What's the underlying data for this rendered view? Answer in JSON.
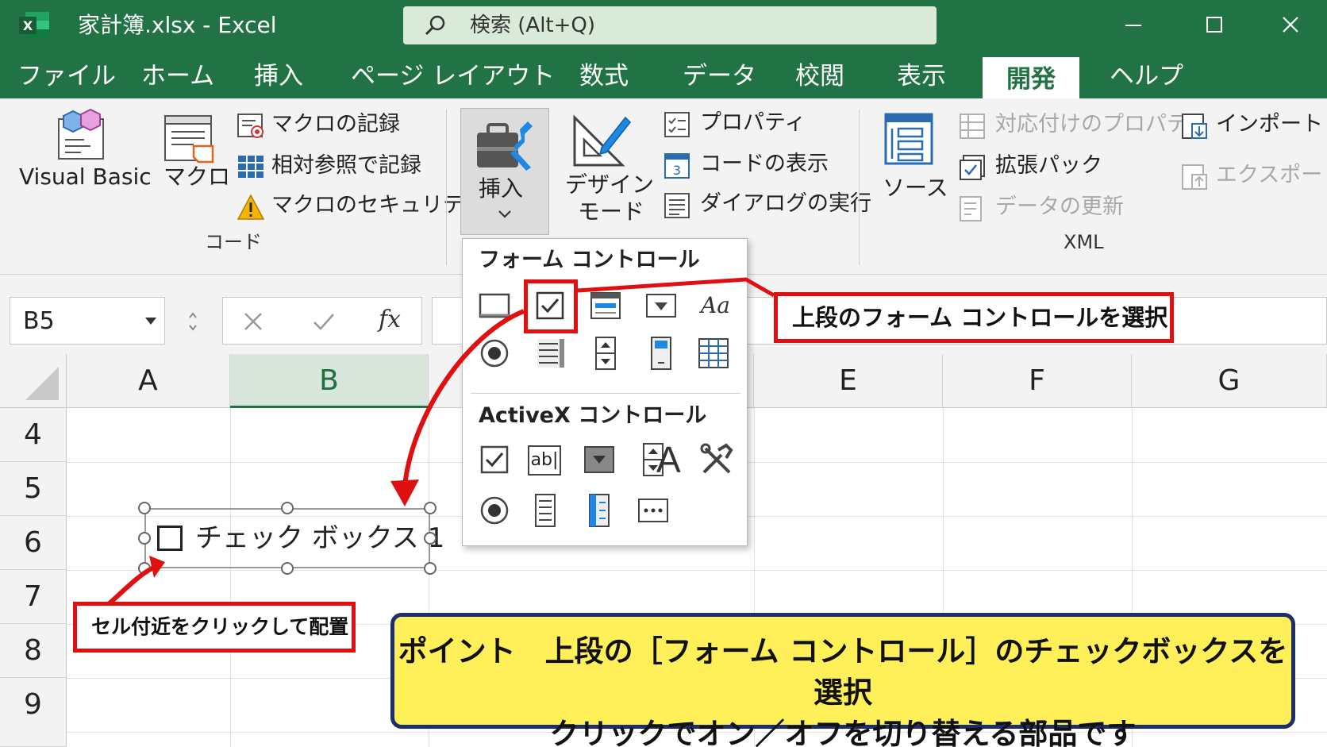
{
  "window": {
    "title": "家計簿.xlsx  -  Excel",
    "app_badge": "X",
    "search_text": "検索 (Alt+Q)"
  },
  "tabs": [
    "ファイル",
    "ホーム",
    "挿入",
    "ページ レイアウト",
    "数式",
    "データ",
    "校閲",
    "表示",
    "開発",
    "ヘルプ"
  ],
  "active_tab": "開発",
  "ribbon": {
    "code_group": {
      "visual_basic": "Visual Basic",
      "macro": "マクロ",
      "record_macro": "マクロの記録",
      "relative_ref": "相対参照で記録",
      "macro_security": "マクロのセキュリティ",
      "label": "コード"
    },
    "controls_group": {
      "insert": "挿入",
      "design_mode_1": "デザイン",
      "design_mode_2": "モード",
      "properties": "プロパティ",
      "view_code": "コードの表示",
      "run_dialog": "ダイアログの実行"
    },
    "xml_group": {
      "source": "ソース",
      "map_properties": "対応付けのプロパティ",
      "expansion_packs": "拡張パック",
      "refresh_data": "データの更新",
      "import": "インポート",
      "export": "エクスポート",
      "label": "XML"
    }
  },
  "formula_bar": {
    "name_box": "B5",
    "fx": "fx"
  },
  "grid": {
    "columns": [
      "A",
      "B",
      "E",
      "F",
      "G"
    ],
    "selected_column": "B",
    "rows": [
      "4",
      "5",
      "6",
      "7",
      "8",
      "9"
    ]
  },
  "gallery": {
    "form_controls_title": "フォーム コントロール",
    "activex_title": "ActiveX コントロール"
  },
  "checkbox_object": {
    "label": "チェック ボックス 1"
  },
  "annotations": {
    "select_form_control": "上段のフォーム コントロールを選択",
    "place_near_cell": "セル付近をクリックして配置",
    "point_line1": "ポイント　上段の［フォーム コントロール］のチェックボックスを選択",
    "point_line2": "クリックでオン／オフを切り替える部品です"
  },
  "colors": {
    "excel_green": "#217346",
    "callout_red": "#e01010",
    "point_yellow": "#fff05a",
    "point_border": "#1a2f6b"
  }
}
